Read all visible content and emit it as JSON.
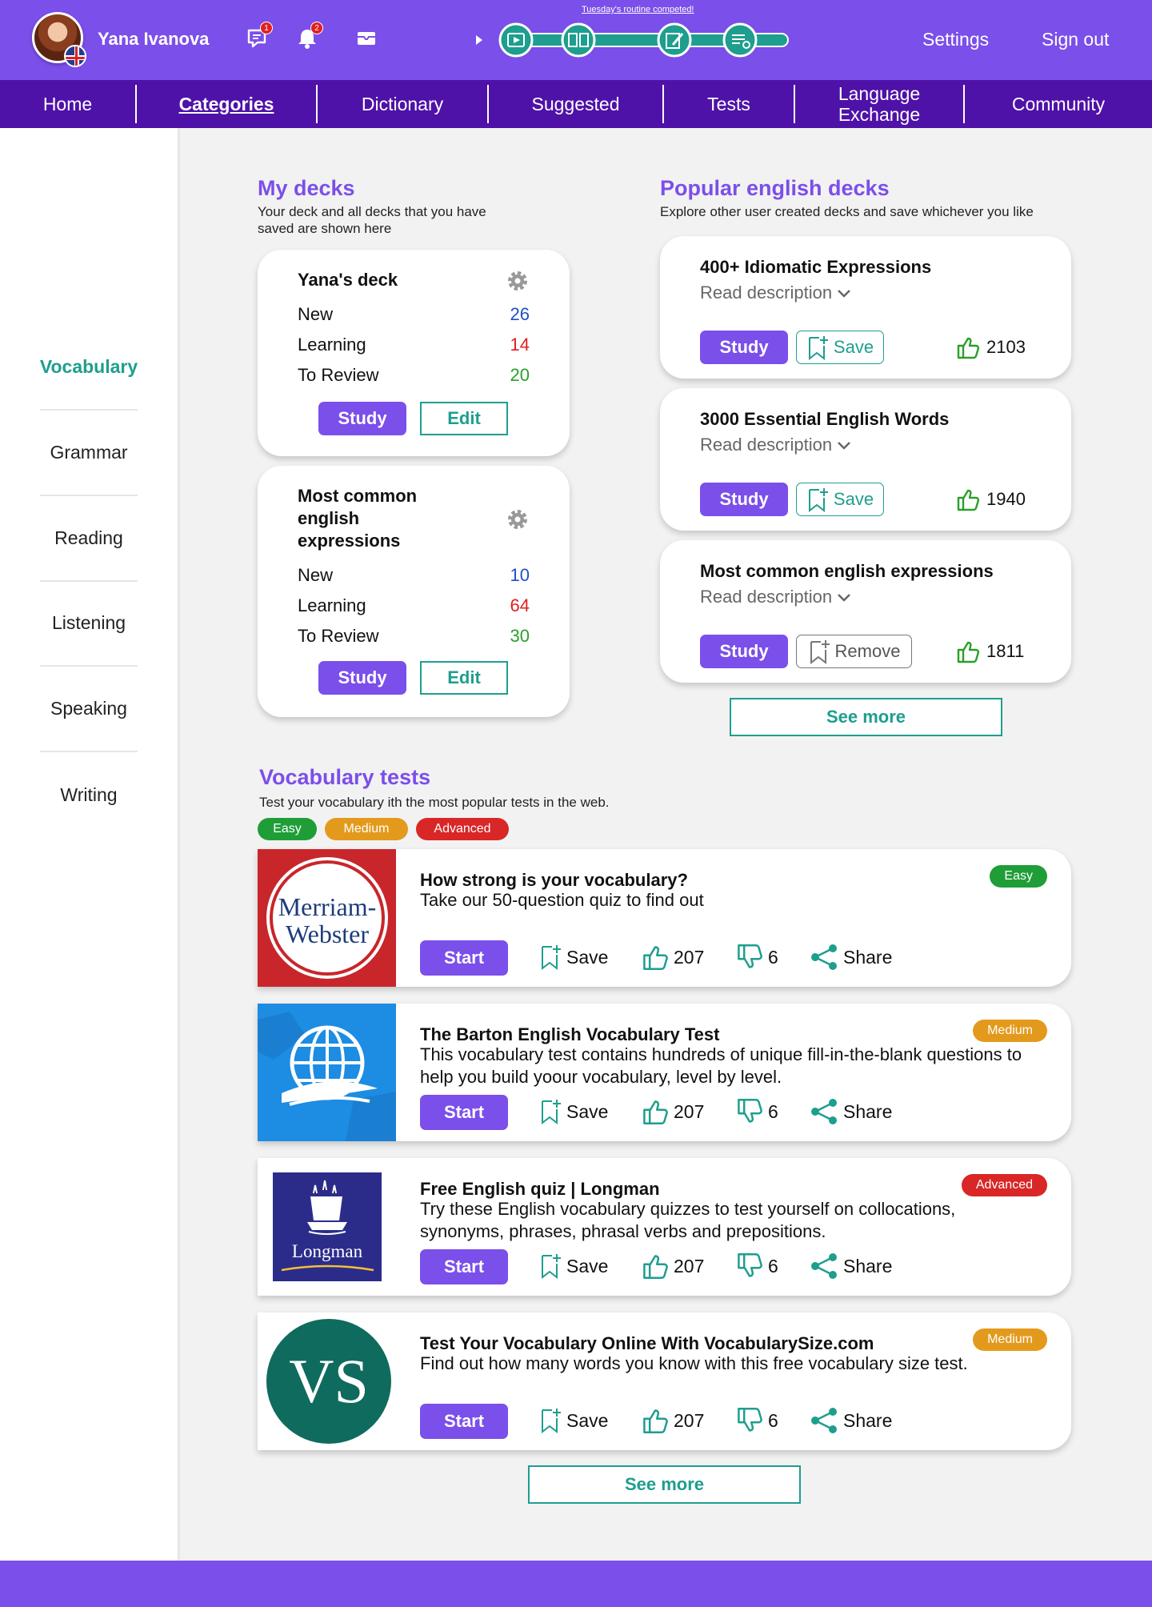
{
  "user": {
    "name": "Yana Ivanova"
  },
  "header": {
    "messages_badge": "1",
    "notifications_badge": "2",
    "routine_text": "Tuesday's routine competed!",
    "settings": "Settings",
    "signout": "Sign out"
  },
  "nav": {
    "items": [
      "Home",
      "Categories",
      "Dictionary",
      "Suggested",
      "Tests",
      "Language Exchange",
      "Community"
    ],
    "active": "Categories"
  },
  "sidebar": {
    "items": [
      "Vocabulary",
      "Grammar",
      "Reading",
      "Listening",
      "Speaking",
      "Writing"
    ],
    "active": "Vocabulary"
  },
  "my_decks": {
    "title": "My decks",
    "subtitle": "Your deck and all decks that you have saved are shown here",
    "decks": [
      {
        "name": "Yana's deck",
        "new_label": "New",
        "new": "26",
        "learning_label": "Learning",
        "learning": "14",
        "review_label": "To Review",
        "review": "20",
        "study": "Study",
        "edit": "Edit"
      },
      {
        "name": "Most common english expressions",
        "new_label": "New",
        "new": "10",
        "learning_label": "Learning",
        "learning": "64",
        "review_label": "To Review",
        "review": "30",
        "study": "Study",
        "edit": "Edit"
      }
    ]
  },
  "popular": {
    "title": "Popular english decks",
    "subtitle": "Explore other user created decks and save whichever you like",
    "decks": [
      {
        "title": "400+ Idiomatic Expressions",
        "read": "Read description",
        "study": "Study",
        "action": "Save",
        "likes": "2103"
      },
      {
        "title": "3000 Essential English Words",
        "read": "Read description",
        "study": "Study",
        "action": "Save",
        "likes": "1940"
      },
      {
        "title": "Most common english expressions",
        "read": "Read description",
        "study": "Study",
        "action": "Remove",
        "likes": "1811"
      }
    ],
    "see_more": "See more"
  },
  "tests": {
    "title": "Vocabulary tests",
    "subtitle": "Test your vocabulary ith the most popular tests in the web.",
    "filters": [
      "Easy",
      "Medium",
      "Advanced"
    ],
    "items": [
      {
        "title": "How strong is your vocabulary?",
        "desc": "Take our 50-question quiz to find out",
        "level": "Easy",
        "logo": "Merriam-Webster",
        "start": "Start",
        "save": "Save",
        "likes": "207",
        "dislikes": "6",
        "share": "Share"
      },
      {
        "title": "The Barton English Vocabulary Test",
        "desc": "This vocabulary test contains hundreds of unique fill-in-the-blank questions to help you build yoour vocabulary, level by level.",
        "level": "Medium",
        "logo": "globe",
        "start": "Start",
        "save": "Save",
        "likes": "207",
        "dislikes": "6",
        "share": "Share"
      },
      {
        "title": "Free English quiz | Longman",
        "desc": "Try these English vocabulary quizzes to test yourself on collocations, synonyms, phrases, phrasal verbs and prepositions.",
        "level": "Advanced",
        "logo": "Longman",
        "start": "Start",
        "save": "Save",
        "likes": "207",
        "dislikes": "6",
        "share": "Share"
      },
      {
        "title": "Test Your Vocabulary Online With VocabularySize.com",
        "desc": "Find out how many words you know with this free vocabulary size test.",
        "level": "Medium",
        "logo": "VS",
        "start": "Start",
        "save": "Save",
        "likes": "207",
        "dislikes": "6",
        "share": "Share"
      }
    ],
    "see_more": "See more"
  },
  "colors": {
    "primary": "#7b4fe9",
    "nav": "#4f12a8",
    "teal": "#1e9e8e",
    "easy": "#1f9e37",
    "medium": "#e39a1c",
    "advanced": "#d92626",
    "new": "#1f4fc9",
    "learning": "#e02020",
    "review": "#2aa02a"
  }
}
